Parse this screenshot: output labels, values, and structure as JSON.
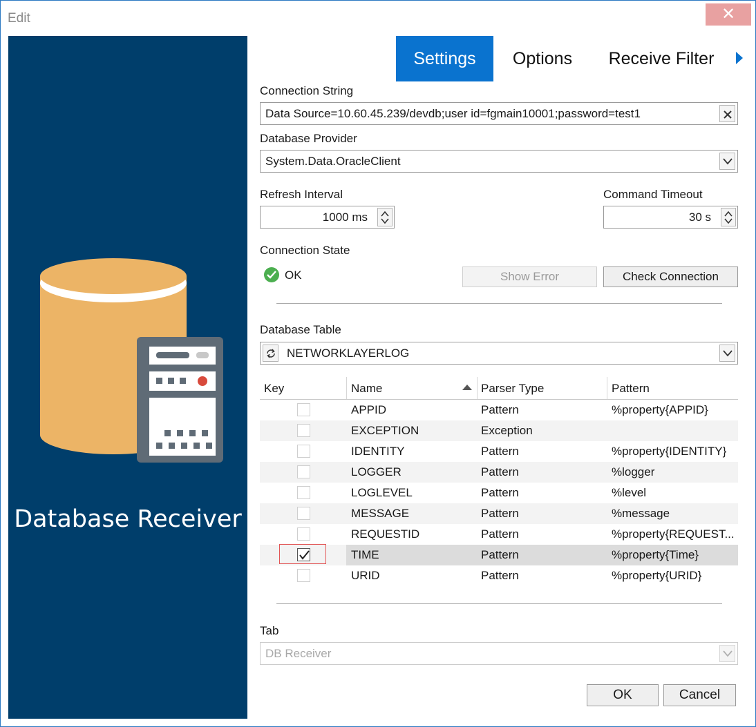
{
  "window": {
    "title": "Edit",
    "close_glyph": "✕"
  },
  "left_panel": {
    "title": "Database Receiver",
    "colors": {
      "background": "#003e6b",
      "cylinder": "#ecb466",
      "device": "#5f6b76"
    }
  },
  "tabs": [
    {
      "label": "Settings",
      "active": true
    },
    {
      "label": "Options",
      "active": false
    },
    {
      "label": "Receive Filter",
      "active": false
    }
  ],
  "settings": {
    "connection_string": {
      "label": "Connection String",
      "value": "Data Source=10.60.45.239/devdb;user id=fgmain10001;password=test1"
    },
    "database_provider": {
      "label": "Database Provider",
      "value": "System.Data.OracleClient"
    },
    "refresh_interval": {
      "label": "Refresh Interval",
      "value": "1000 ms"
    },
    "command_timeout": {
      "label": "Command Timeout",
      "value": "30 s"
    },
    "connection_state": {
      "label": "Connection State",
      "status": "OK"
    },
    "show_error_label": "Show Error",
    "check_connection_label": "Check Connection",
    "database_table": {
      "label": "Database Table",
      "value": "NETWORKLAYERLOG"
    }
  },
  "grid": {
    "columns": [
      "Key",
      "Name",
      "Parser Type",
      "Pattern"
    ],
    "rows": [
      {
        "key": false,
        "name": "APPID",
        "parser": "Pattern",
        "pattern": "%property{APPID}"
      },
      {
        "key": false,
        "name": "EXCEPTION",
        "parser": "Exception",
        "pattern": ""
      },
      {
        "key": false,
        "name": "IDENTITY",
        "parser": "Pattern",
        "pattern": "%property{IDENTITY}"
      },
      {
        "key": false,
        "name": "LOGGER",
        "parser": "Pattern",
        "pattern": "%logger"
      },
      {
        "key": false,
        "name": "LOGLEVEL",
        "parser": "Pattern",
        "pattern": "%level"
      },
      {
        "key": false,
        "name": "MESSAGE",
        "parser": "Pattern",
        "pattern": "%message"
      },
      {
        "key": false,
        "name": "REQUESTID",
        "parser": "Pattern",
        "pattern": "%property{REQUEST..."
      },
      {
        "key": true,
        "name": "TIME",
        "parser": "Pattern",
        "pattern": "%property{Time}",
        "selected": true
      },
      {
        "key": false,
        "name": "URID",
        "parser": "Pattern",
        "pattern": "%property{URID}"
      }
    ]
  },
  "tab_field": {
    "label": "Tab",
    "value": "DB Receiver"
  },
  "buttons": {
    "ok": "OK",
    "cancel": "Cancel"
  },
  "colors": {
    "accent": "#0a73cf",
    "ok_green": "#4caf50",
    "highlight_red": "#e25555"
  }
}
